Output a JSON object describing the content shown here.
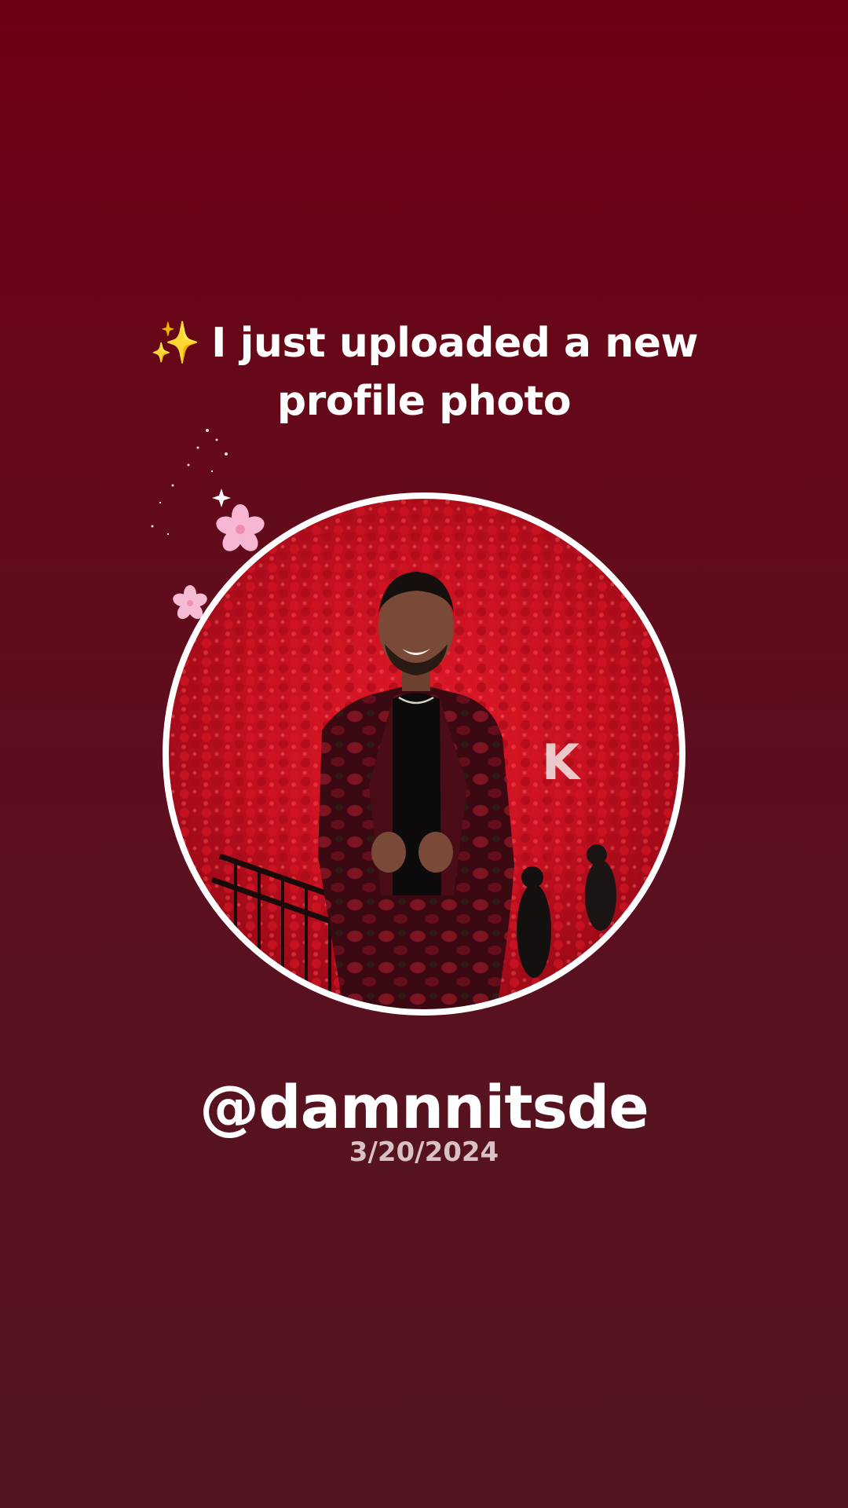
{
  "announcement": {
    "sparkle_icon": "sparkles-icon",
    "sparkle_glyph": "✨",
    "text": "I just uploaded a new profile photo"
  },
  "profile": {
    "handle": "@damnnitsde",
    "date": "3/20/2024"
  },
  "colors": {
    "background_top": "#6e0013",
    "background_bottom": "#521620",
    "text": "#ffffff",
    "date_text": "#d8c2c6",
    "avatar_border": "#ffffff",
    "blossom": "#f7b6d2"
  }
}
